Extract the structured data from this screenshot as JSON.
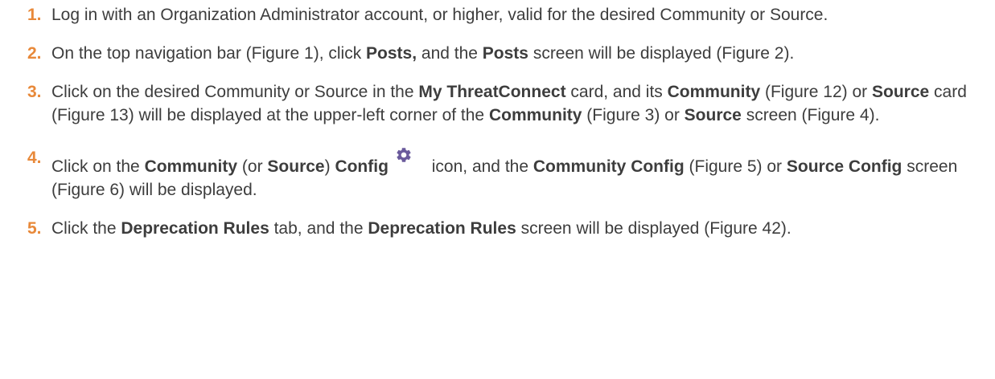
{
  "steps": [
    {
      "number": "1.",
      "parts": [
        "Log in with an Organization Administrator account, or higher, valid for the desired Community or Source."
      ]
    },
    {
      "number": "2.",
      "parts": [
        "On the top navigation bar (Figure 1), click ",
        "Posts,",
        " and the ",
        "Posts",
        " screen will be displayed (Figure 2)."
      ]
    },
    {
      "number": "3.",
      "parts": [
        "Click on the desired Community or Source in the ",
        "My ThreatConnect",
        " card, and its ",
        "Community",
        " (Figure 12) or ",
        "Source",
        " card (Figure 13) will be displayed at the upper-left corner of the ",
        "Community",
        " (Figure 3) or ",
        "Source",
        " screen (Figure 4)."
      ]
    },
    {
      "number": "4.",
      "parts": [
        "Click on the ",
        "Community",
        " (or ",
        "Source",
        ") ",
        "Config",
        " icon, and the ",
        "Community Config",
        " (Figure 5) or ",
        "Source Config",
        " screen (Figure 6) will be displayed."
      ],
      "icon": "gear-icon"
    },
    {
      "number": "5.",
      "parts": [
        "Click the ",
        "Deprecation Rules",
        " tab, and the ",
        "Deprecation Rules",
        " screen will be displayed (Figure 42)."
      ]
    }
  ],
  "colors": {
    "number": "#e8893a",
    "text": "#3d3d3d",
    "icon": "#6a5a9c"
  }
}
